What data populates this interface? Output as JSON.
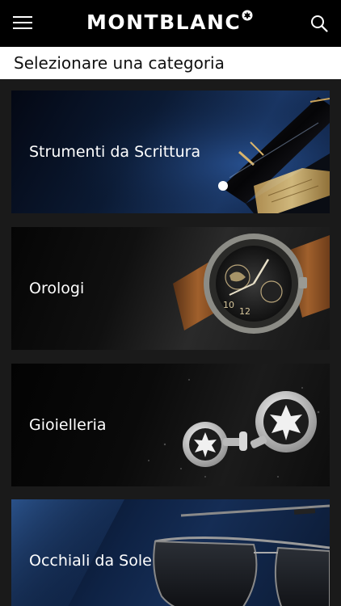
{
  "header": {
    "brand": "MONTBLANC",
    "menu_icon": "hamburger-menu-icon",
    "search_icon": "search-icon",
    "background": "#000000"
  },
  "subheader": {
    "title": "Selezionare una categoria"
  },
  "categories": [
    {
      "label": "Strumenti da Scrittura",
      "image": "fountain-pen-image"
    },
    {
      "label": "Orologi",
      "image": "watch-image"
    },
    {
      "label": "Gioielleria",
      "image": "cufflinks-image"
    },
    {
      "label": "Occhiali da Sole",
      "image": "sunglasses-image"
    }
  ],
  "colors": {
    "page_background": "#1a1a1a",
    "text_on_image": "#ffffff",
    "subheader_background": "#ffffff"
  }
}
